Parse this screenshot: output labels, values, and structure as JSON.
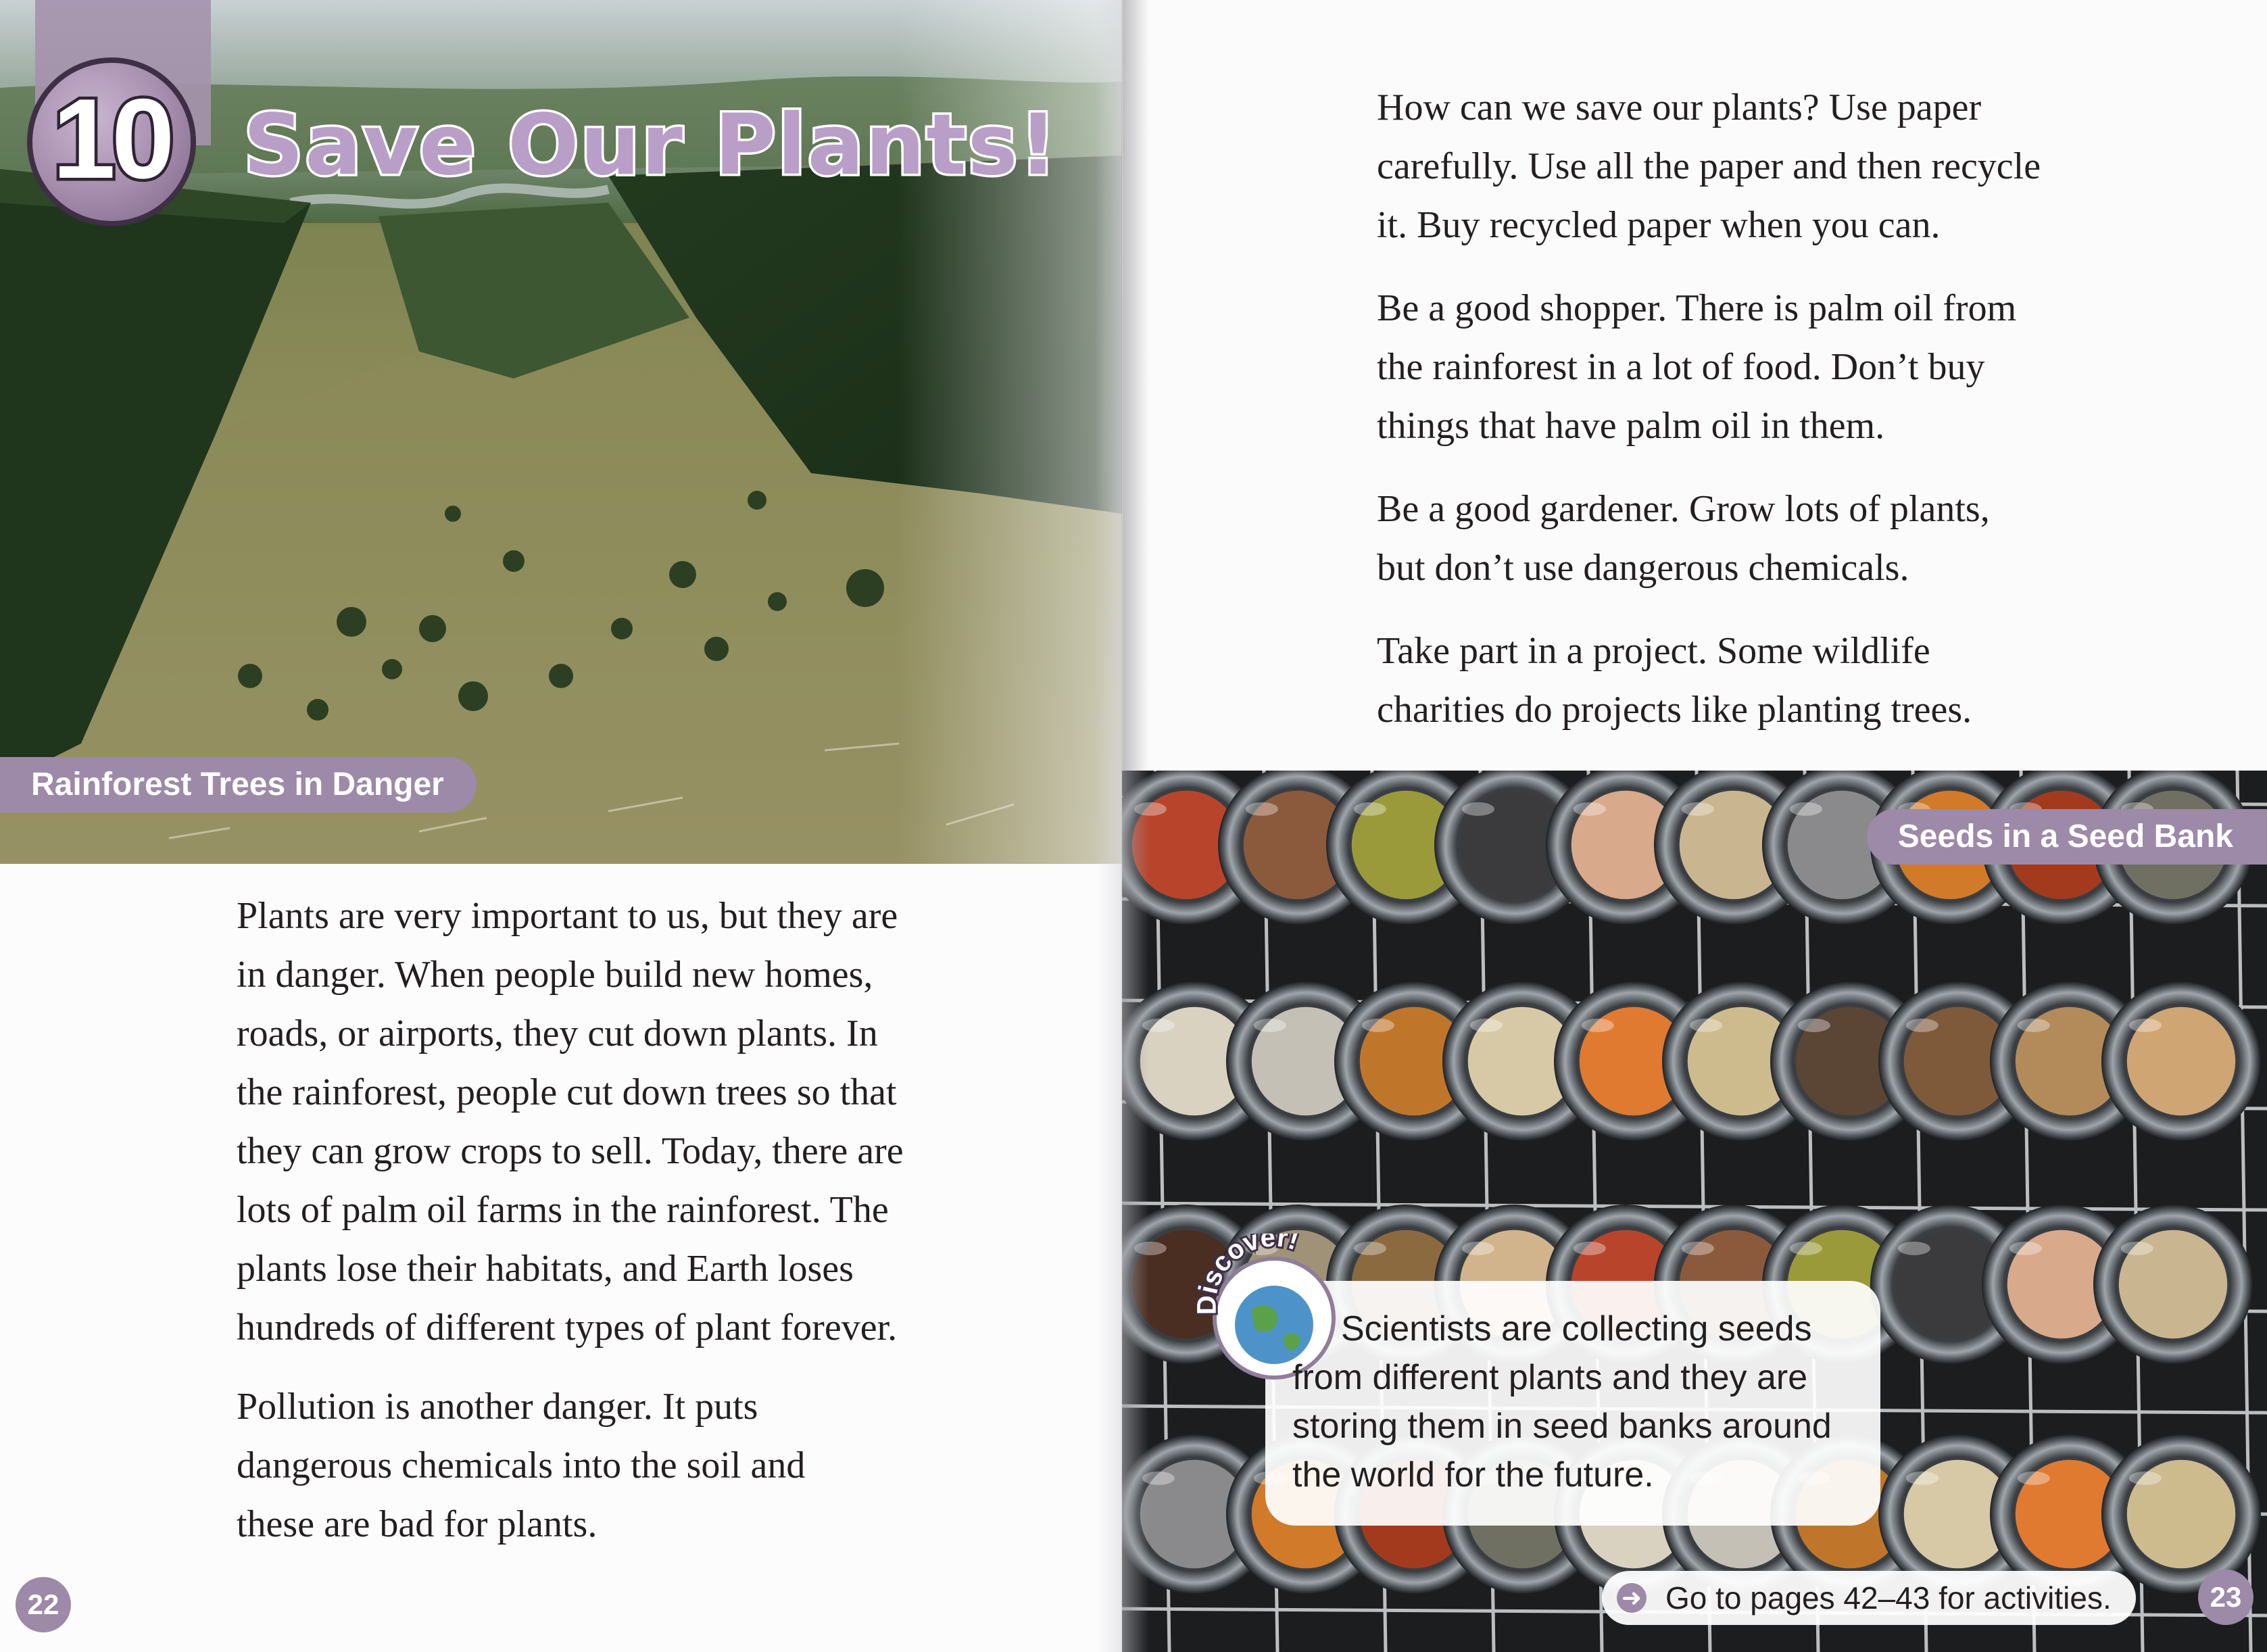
{
  "chapter": {
    "number": "10",
    "title": "Save Our Plants!"
  },
  "left_page": {
    "photo_caption": "Rainforest Trees in Danger",
    "paragraphs": [
      {
        "lines": [
          "Plants are very important to us, but they are",
          "in danger. When people build new homes,",
          "roads, or airports, they cut down plants. In",
          "the rainforest, people cut down trees so that",
          "they can grow crops to sell. Today, there are",
          "lots of palm oil farms in the rainforest. The",
          "plants lose their habitats, and Earth loses",
          "hundreds of different types of plant forever."
        ]
      },
      {
        "lines": [
          "Pollution is another danger. It puts",
          "dangerous chemicals into the soil and",
          "these are bad for plants."
        ]
      }
    ],
    "page_number": "22"
  },
  "right_page": {
    "paragraphs": [
      {
        "lines": [
          "How can we save our plants? Use paper",
          "carefully. Use all the paper and then recycle",
          "it. Buy recycled paper when you can."
        ]
      },
      {
        "lines": [
          "Be a good shopper. There is palm oil from",
          "the rainforest in a lot of food. Don’t buy",
          "things that have palm oil in them."
        ]
      },
      {
        "lines": [
          "Be a good gardener. Grow lots of plants,",
          "but don’t use dangerous chemicals."
        ]
      },
      {
        "lines": [
          "Take part in a project. Some wildlife",
          "charities do projects like planting trees."
        ]
      }
    ],
    "photo_caption": "Seeds in a Seed Bank",
    "discover": {
      "badge_label": "Discover!",
      "lines": [
        "Scientists are collecting seeds",
        "from different plants and they are",
        "storing them in seed banks around",
        "the world for the future."
      ]
    },
    "activity_link": "Go to pages 42–43 for activities.",
    "page_number": "23"
  },
  "colors": {
    "accent_purple": "#9d89a8",
    "title_lilac": "#b99fc7",
    "body_text": "#231f20"
  }
}
